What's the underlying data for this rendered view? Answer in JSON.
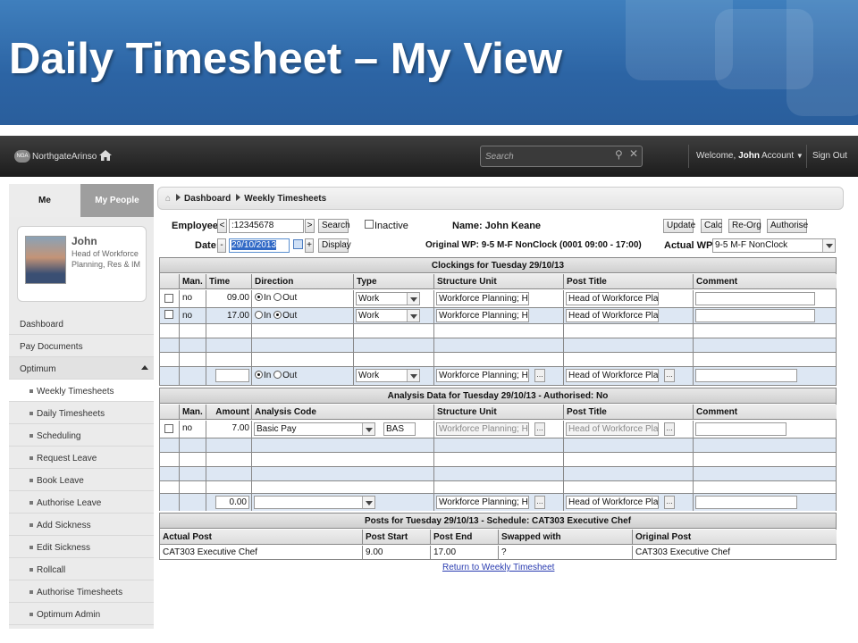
{
  "slide": {
    "title": "Daily Timesheet – My View"
  },
  "topbar": {
    "logo_badge": "NGA",
    "logo_text": "NorthgateArinso",
    "search_placeholder": "Search",
    "welcome_prefix": "Welcome,",
    "welcome_user": "John",
    "account_label": "Account",
    "signout_label": "Sign Out"
  },
  "sidebar": {
    "tabs": [
      "Me",
      "My People"
    ],
    "profile": {
      "name": "John",
      "role": "Head of Workforce Planning, Res & IM"
    },
    "items": [
      {
        "label": "Dashboard"
      },
      {
        "label": "Pay Documents"
      },
      {
        "label": "Optimum"
      },
      {
        "label": "Weekly Timesheets"
      },
      {
        "label": "Daily Timesheets"
      },
      {
        "label": "Scheduling"
      },
      {
        "label": "Request Leave"
      },
      {
        "label": "Book Leave"
      },
      {
        "label": "Authorise Leave"
      },
      {
        "label": "Add Sickness"
      },
      {
        "label": "Edit Sickness"
      },
      {
        "label": "Rollcall"
      },
      {
        "label": "Authorise Timesheets"
      },
      {
        "label": "Optimum Admin"
      }
    ]
  },
  "breadcrumb": [
    "Dashboard",
    "Weekly Timesheets"
  ],
  "form": {
    "employee_label": "Employee:",
    "employee_value": ":12345678",
    "prev": "<",
    "next": ">",
    "search_btn": "Search",
    "inactive_label": "Inactive",
    "name_text": "Name: John Keane",
    "update_btn": "Update",
    "calc_btn": "Calc",
    "reorg_btn": "Re-Org",
    "authorise_btn": "Authorise",
    "date_label": "Date:",
    "date_minus": "-",
    "date_value": "29/10/2013",
    "date_plus": "+",
    "display_btn": "Display",
    "original_wp": "Original WP: 9-5 M-F NonClock (0001 09:00 - 17:00)",
    "actual_wp_label": "Actual WP:",
    "actual_wp_value": "9-5 M-F NonClock"
  },
  "clockings": {
    "title": "Clockings for Tuesday 29/10/13",
    "columns": [
      "Man.",
      "Time",
      "Direction",
      "Type",
      "Structure Unit",
      "Post Title",
      "Comment"
    ],
    "rows": [
      {
        "man": "no",
        "time": "09.00",
        "dir_in": "In",
        "dir_out": "Out",
        "in_selected": true,
        "type": "Work",
        "unit": "Workforce Planning; HF",
        "post": "Head of Workforce Plan"
      },
      {
        "man": "no",
        "time": "17.00",
        "dir_in": "In",
        "dir_out": "Out",
        "in_selected": false,
        "type": "Work",
        "unit": "Workforce Planning; HF",
        "post": "Head of Workforce Plan"
      }
    ],
    "new_row": {
      "dir_in": "In",
      "dir_out": "Out",
      "type": "Work",
      "unit": "Workforce Planning; HF",
      "post": "Head of Workforce Plan",
      "dots": "..."
    }
  },
  "analysis": {
    "title": "Analysis Data for Tuesday 29/10/13 - Authorised: No",
    "columns": [
      "Man.",
      "Amount",
      "Analysis Code",
      "Structure Unit",
      "Post Title",
      "Comment"
    ],
    "row": {
      "man": "no",
      "amount": "7.00",
      "code": "Basic Pay",
      "code_short": "BAS",
      "unit": "Workforce Planning; HF",
      "post": "Head of Workforce Plan"
    },
    "new_row": {
      "amount": "0.00",
      "unit": "Workforce Planning; HF",
      "post": "Head of Workforce Plan"
    }
  },
  "posts": {
    "title": "Posts for Tuesday 29/10/13 - Schedule: CAT303 Executive Chef",
    "columns": [
      "Actual Post",
      "Post Start",
      "Post End",
      "Swapped with",
      "Original Post"
    ],
    "row": {
      "actual": "CAT303 Executive Chef",
      "start": "9.00",
      "end": "17.00",
      "swapped": "?",
      "original": "CAT303 Executive Chef"
    }
  },
  "return_link": "Return to Weekly Timesheet"
}
